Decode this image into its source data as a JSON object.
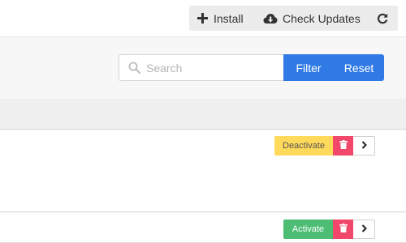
{
  "toolbar": {
    "install_label": "Install",
    "install_icon": "plus-icon",
    "check_updates_label": "Check Updates",
    "check_updates_icon": "cloud-download-icon",
    "refresh_icon": "refresh-icon"
  },
  "filter_bar": {
    "search_placeholder": "Search",
    "search_value": "",
    "search_icon": "search-icon",
    "filter_label": "Filter",
    "reset_label": "Reset"
  },
  "rows": [
    {
      "toggle_label": "Deactivate",
      "toggle_color": "#ffd95a",
      "delete_icon": "trash-icon",
      "more_icon": "chevron-right-icon"
    },
    {
      "toggle_label": "Activate",
      "toggle_color": "#4dbd74",
      "delete_icon": "trash-icon",
      "more_icon": "chevron-right-icon"
    }
  ],
  "colors": {
    "primary": "#2f7ae5",
    "danger": "#f1476a",
    "warning": "#ffd95a",
    "success": "#4dbd74"
  }
}
